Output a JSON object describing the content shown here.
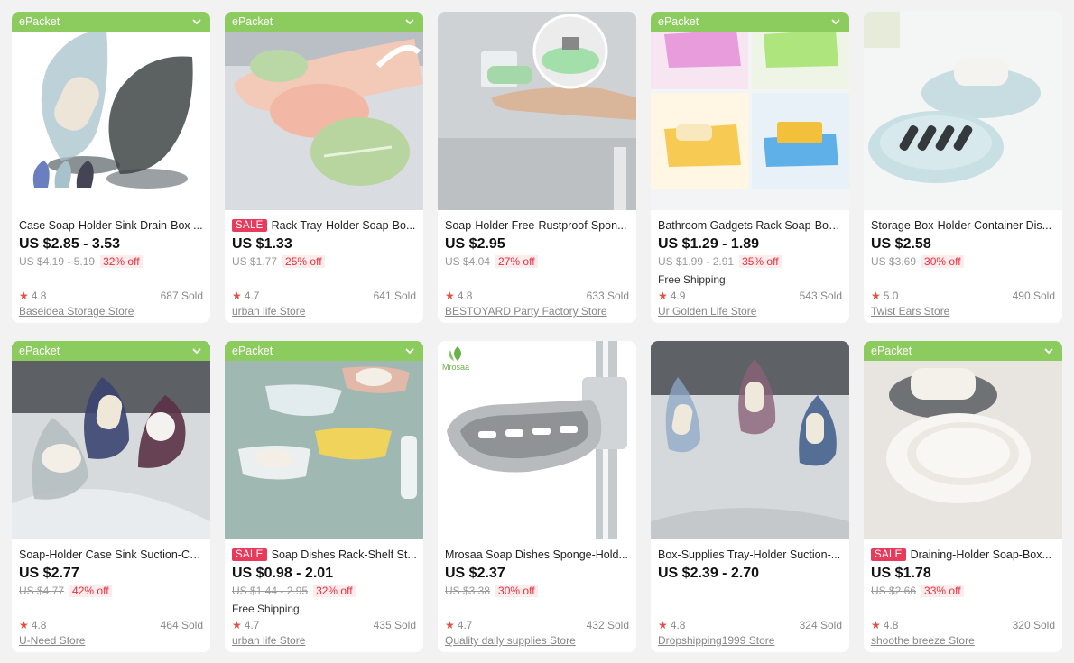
{
  "products": [
    {
      "epacket": "ePacket",
      "sale": "",
      "title": "Case Soap-Holder Sink Drain-Box ...",
      "price": "US $2.85 - 3.53",
      "orig": "US $4.19 - 5.19",
      "off": "32% off",
      "shipping": "",
      "rating": "4.8",
      "sold": "687 Sold",
      "store": "Baseidea Storage Store",
      "img": "leaf-clear"
    },
    {
      "epacket": "ePacket",
      "sale": "SALE",
      "title": "Rack Tray-Holder Soap-Bo...",
      "price": "US $1.33",
      "orig": "US $1.77",
      "off": "25% off",
      "shipping": "",
      "rating": "4.7",
      "sold": "641 Sold",
      "store": "urban life Store",
      "img": "leaf-pastel"
    },
    {
      "epacket": "",
      "sale": "",
      "title": "Soap-Holder Free-Rustproof-Spon...",
      "price": "US $2.95",
      "orig": "US $4.04",
      "off": "27% off",
      "shipping": "",
      "rating": "4.8",
      "sold": "633 Sold",
      "store": "BESTOYARD Party Factory Store",
      "img": "magnet"
    },
    {
      "epacket": "ePacket",
      "sale": "",
      "title": "Bathroom Gadgets Rack Soap-Box ...",
      "price": "US $1.29 - 1.89",
      "orig": "US $1.99 - 2.91",
      "off": "35% off",
      "shipping": "Free Shipping",
      "rating": "4.9",
      "sold": "543 Sold",
      "store": "Ur Golden Life Store",
      "img": "waterfall"
    },
    {
      "epacket": "",
      "sale": "",
      "title": "Storage-Box-Holder Container Dis...",
      "price": "US $2.58",
      "orig": "US $3.69",
      "off": "30% off",
      "shipping": "",
      "rating": "5.0",
      "sold": "490 Sold",
      "store": "Twist Ears Store",
      "img": "dish-blue"
    },
    {
      "epacket": "ePacket",
      "sale": "",
      "title": "Soap-Holder Case Sink Suction-Cu...",
      "price": "US $2.77",
      "orig": "US $4.77",
      "off": "42% off",
      "shipping": "",
      "rating": "4.8",
      "sold": "464 Sold",
      "store": "U-Need Store",
      "img": "leaf-dark"
    },
    {
      "epacket": "ePacket",
      "sale": "SALE",
      "title": "Soap Dishes Rack-Shelf St...",
      "price": "US $0.98 - 2.01",
      "orig": "US $1.44 - 2.95",
      "off": "32% off",
      "shipping": "Free Shipping",
      "rating": "4.7",
      "sold": "435 Sold",
      "store": "urban life Store",
      "img": "wall-shelves"
    },
    {
      "epacket": "",
      "sale": "",
      "title": "Mrosaa Soap Dishes Sponge-Hold...",
      "price": "US $2.37",
      "orig": "US $3.38",
      "off": "30% off",
      "shipping": "",
      "rating": "4.7",
      "sold": "432 Sold",
      "store": "Quality daily supplies Store",
      "img": "chrome",
      "logo": "Mrosaa"
    },
    {
      "epacket": "",
      "sale": "",
      "title": "Box-Supplies Tray-Holder Suction-...",
      "price": "US $2.39 - 2.70",
      "orig": "",
      "off": "",
      "shipping": "",
      "rating": "4.8",
      "sold": "324 Sold",
      "store": "Dropshipping1999 Store",
      "img": "leaf-trio"
    },
    {
      "epacket": "ePacket",
      "sale": "SALE",
      "title": "Draining-Holder Soap-Box...",
      "price": "US $1.78",
      "orig": "US $2.66",
      "off": "33% off",
      "shipping": "",
      "rating": "4.8",
      "sold": "320 Sold",
      "store": "shoothe breeze Store",
      "img": "dish-white"
    }
  ],
  "colors": {
    "epacket": "#8ccb5e",
    "sale": "#e83a5b",
    "off": "#e8303f",
    "star": "#e24f43"
  },
  "icons": {
    "chevron": "chevron-down-icon",
    "star": "star-icon"
  }
}
